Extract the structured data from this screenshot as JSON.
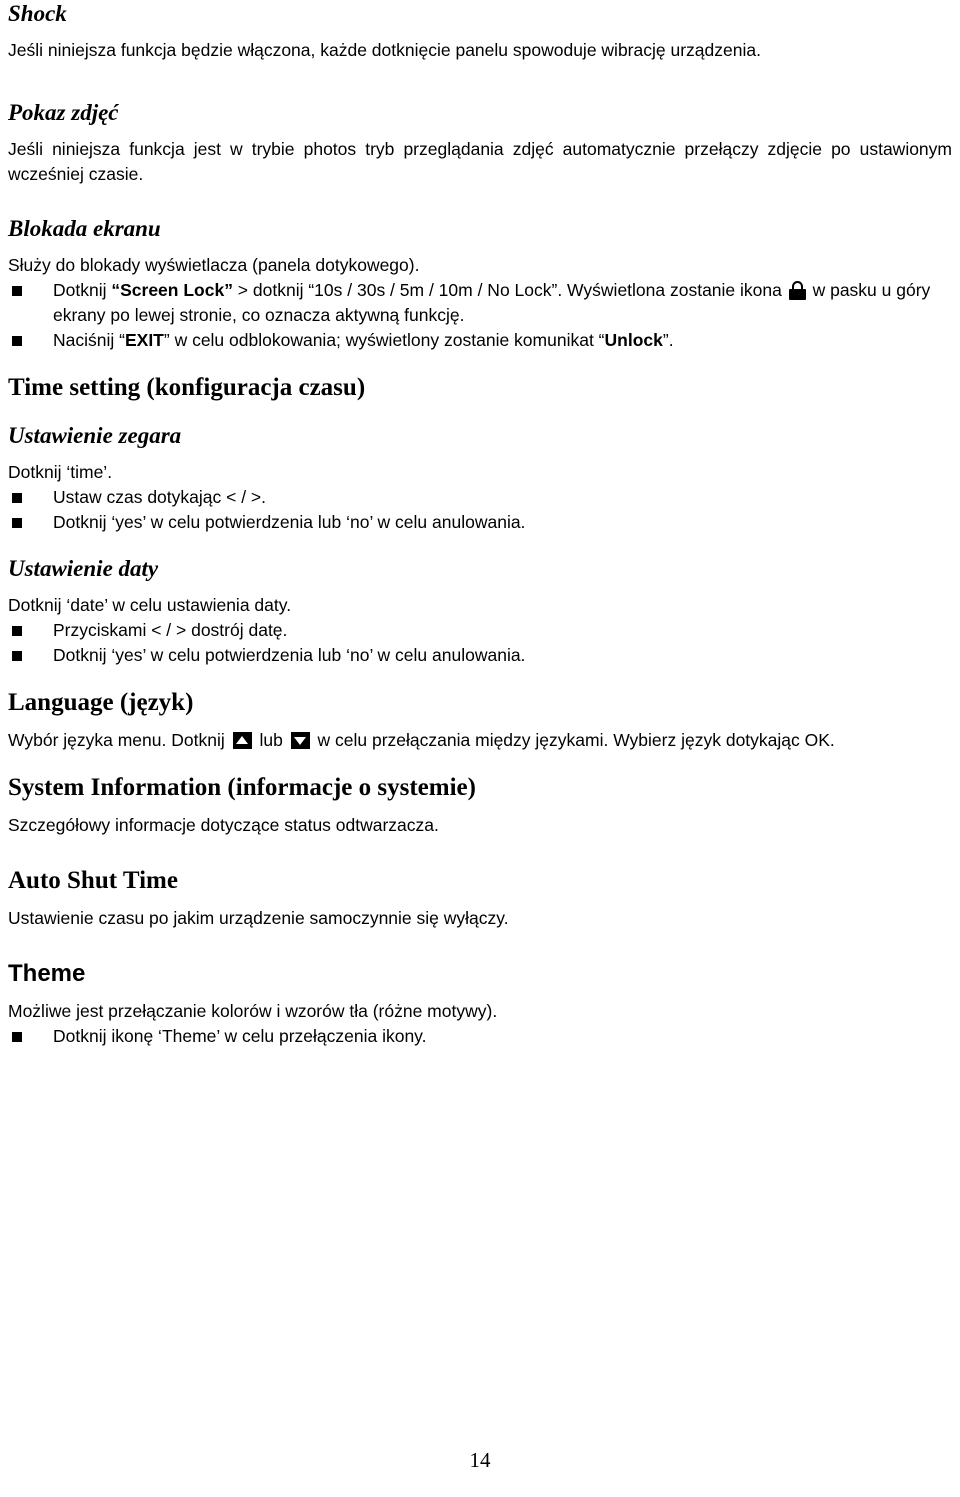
{
  "document": {
    "page_number": "14",
    "sections": [
      {
        "id": "shock",
        "heading": "Shock",
        "paragraph": "Jeśli niniejsza funkcja będzie włączona, każde dotknięcie panelu spowoduje wibrację urządzenia."
      },
      {
        "id": "pokaz-zdjec",
        "heading": "Pokaz zdjęć",
        "paragraph": "Jeśli niniejsza funkcja jest w trybie photos tryb przeglądania zdjęć automatycznie przełączy zdjęcie po ustawionym wcześniej czasie."
      },
      {
        "id": "blokada-ekranu",
        "heading": "Blokada ekranu",
        "paragraph": "Służy do blokady wyświetlacza (panela dotykowego).",
        "bullets": [
          {
            "part1": "Dotknij ",
            "bold1": "Screen Lock",
            "part2": " > dotknij ",
            "plain2": "10s / 30s / 5m / 10m / No Lock",
            "part3": ". Wyświetlona zostanie ikona ",
            "icon": "lock-icon",
            "part4": " w pasku u góry ekrany po lewej stronie, co oznacza aktywną funkcję."
          },
          {
            "part1": "Naciśnij ",
            "bold1": "EXIT",
            "part2": " w celu odblokowania; wyświetlony zostanie komunikat ",
            "bold2": "Unlock",
            "part3": "."
          }
        ]
      },
      {
        "id": "time-setting",
        "heading": "Time setting (konfiguracja czasu)",
        "subsections": [
          {
            "id": "ustawienie-zegara",
            "heading": "Ustawienie zegara",
            "paragraph": "Dotknij ‘time’.",
            "bullets": [
              "Ustaw czas dotykając < / >.",
              "Dotknij ‘yes’ w celu potwierdzenia lub ‘no’ w celu anulowania."
            ]
          },
          {
            "id": "ustawienie-daty",
            "heading": "Ustawienie daty",
            "paragraph": "Dotknij ‘date’ w celu ustawienia daty.",
            "bullets": [
              "Przyciskami < / > dostrój datę.",
              "Dotknij ‘yes’ w celu potwierdzenia lub ‘no’ w celu anulowania."
            ]
          }
        ]
      },
      {
        "id": "language",
        "heading": "Language (język)",
        "paragraph_part1": "Wybór języka menu. Dotknij ",
        "icon1": "triangle-up-icon",
        "paragraph_part2": " lub ",
        "icon2": "triangle-down-icon",
        "paragraph_part3": " w celu przełączania między językami. Wybierz język dotykając OK."
      },
      {
        "id": "system-information",
        "heading": "System Information (informacje o systemie)",
        "paragraph": "Szczegółowy informacje dotyczące status odtwarzacza."
      },
      {
        "id": "auto-shut-time",
        "heading": "Auto Shut Time",
        "paragraph": "Ustawienie czasu po jakim urządzenie samoczynnie się wyłączy."
      },
      {
        "id": "theme",
        "heading": "Theme",
        "paragraph": "Możliwe jest przełączanie kolorów i wzorów tła (różne motywy).",
        "bullets": [
          "Dotknij ikonę ‘Theme’ w celu przełączenia ikony."
        ]
      }
    ]
  }
}
